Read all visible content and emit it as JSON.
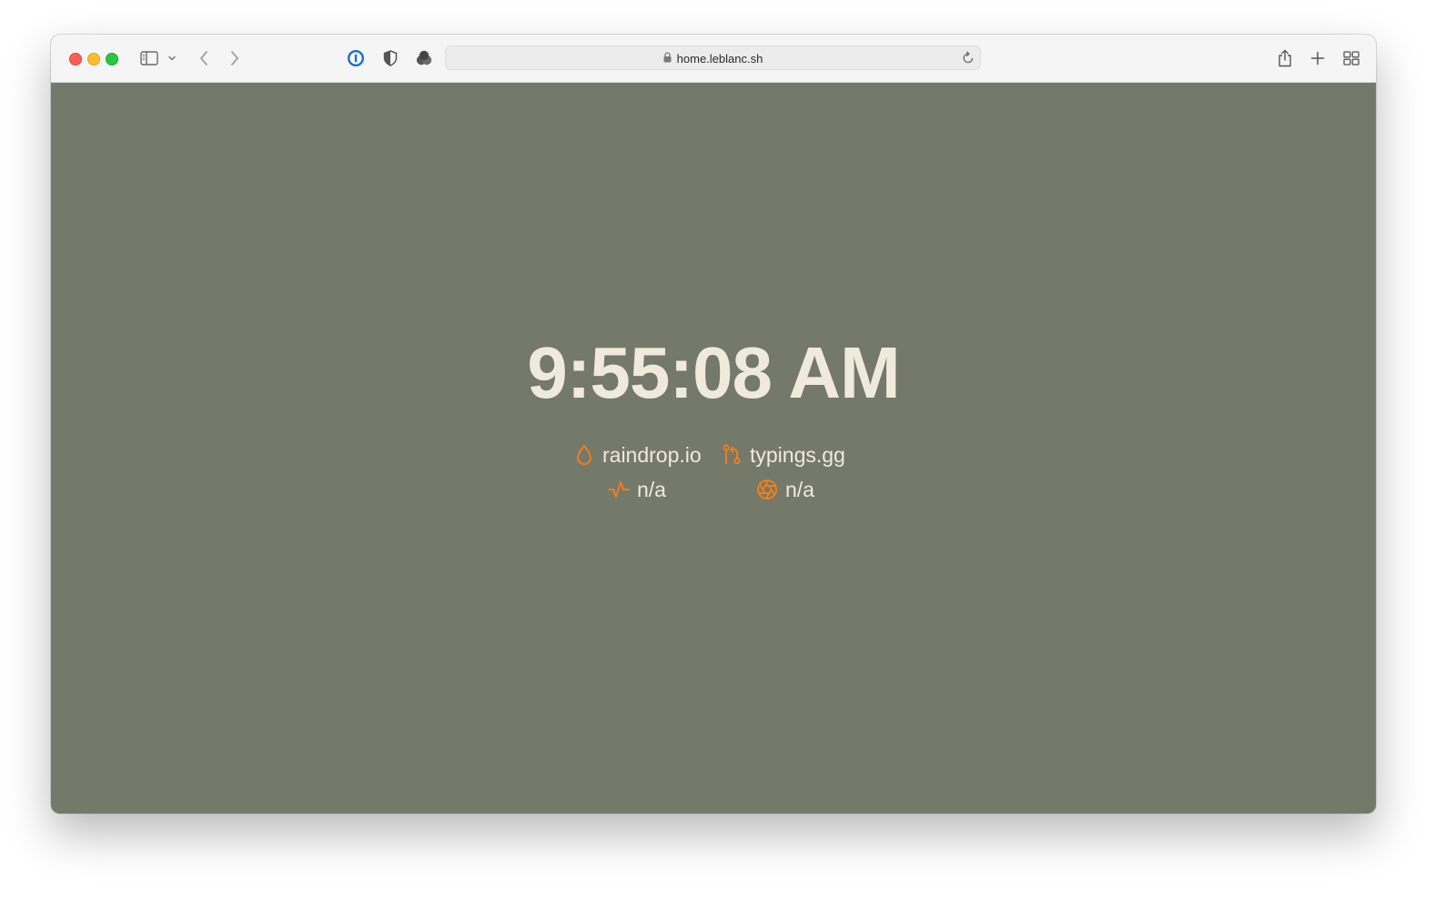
{
  "browser": {
    "url": "home.leblanc.sh"
  },
  "page": {
    "clock": "9:55:08 AM",
    "stats": [
      {
        "icon": "raindrop-icon",
        "label": "raindrop.io"
      },
      {
        "icon": "git-pull-request-icon",
        "label": "typings.gg"
      },
      {
        "icon": "activity-icon",
        "label": "n/a"
      },
      {
        "icon": "aperture-icon",
        "label": "n/a"
      }
    ]
  },
  "colors": {
    "background": "#75796a",
    "text": "#efeadb",
    "accent": "#f07f1b"
  }
}
